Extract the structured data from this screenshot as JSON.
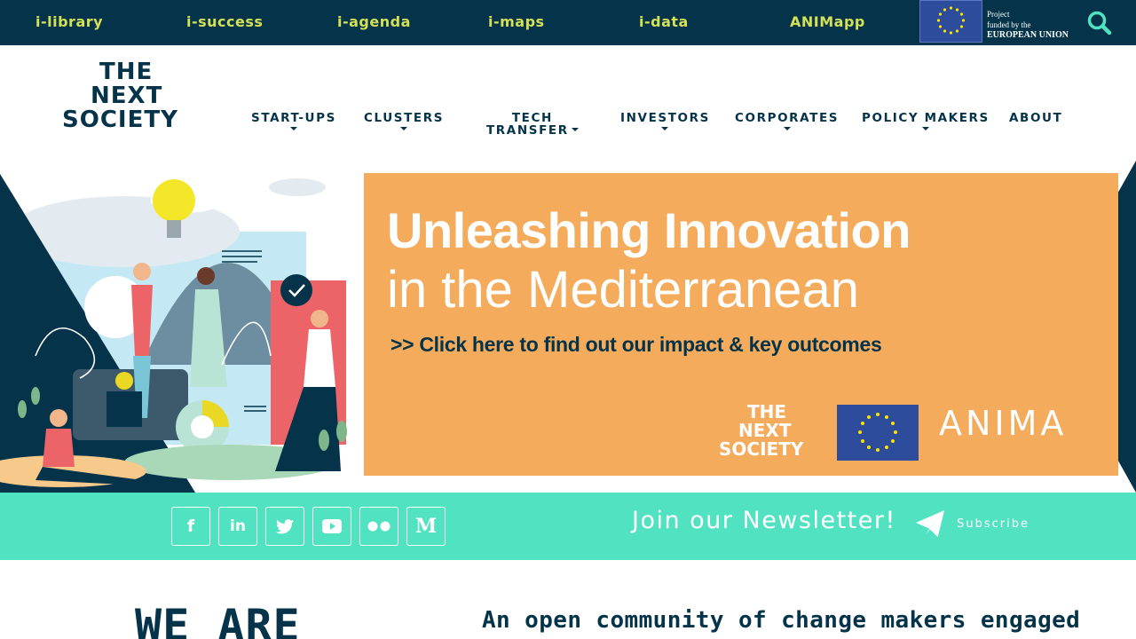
{
  "topbar": {
    "links": [
      "i-library",
      "i-success",
      "i-agenda",
      "i-maps",
      "i-data",
      "ANIMapp"
    ],
    "eu_line1": "Project",
    "eu_line2": "funded by the",
    "eu_line3": "EUROPEAN UNION",
    "search_icon": "search-icon"
  },
  "logo": {
    "lines": [
      "THE",
      "NEXT",
      "SOCIETY"
    ]
  },
  "nav": {
    "items": [
      {
        "label": "START-UPS",
        "dropdown": true
      },
      {
        "label": "CLUSTERS",
        "dropdown": true
      },
      {
        "label": "TECH",
        "label2": "TRANSFER",
        "dropdown": true
      },
      {
        "label": "INVESTORS",
        "dropdown": true
      },
      {
        "label": "CORPORATES",
        "dropdown": true
      },
      {
        "label": "POLICY MAKERS",
        "dropdown": true
      },
      {
        "label": "ABOUT",
        "dropdown": false
      }
    ]
  },
  "hero": {
    "title_line1": "Unleashing Innovation",
    "title_line2": "in the Mediterranean",
    "cta": ">> Click here to find out our impact & key outcomes",
    "tns_logo": [
      "THE",
      "NEXT",
      "SOCIETY"
    ],
    "anima": "ANIMA",
    "colors": {
      "orange": "#f4ab5c",
      "navy": "#04334a",
      "red": "#ec6468"
    }
  },
  "social": {
    "icons": [
      "facebook-icon",
      "linkedin-icon",
      "twitter-icon",
      "youtube-icon",
      "flickr-icon",
      "medium-icon"
    ],
    "glyphs": [
      "f",
      "in",
      "",
      "",
      "",
      "M"
    ],
    "newsletter": "Join our Newsletter!",
    "subscribe": "Subscribe"
  },
  "intro": {
    "heading": "WE ARE",
    "text": "An open community of change makers engaged in innovation and economic development"
  },
  "colors": {
    "navy": "#04334a",
    "lime": "#d4e157",
    "teal": "#51e2c2",
    "eu_blue": "#2e4c9c"
  }
}
